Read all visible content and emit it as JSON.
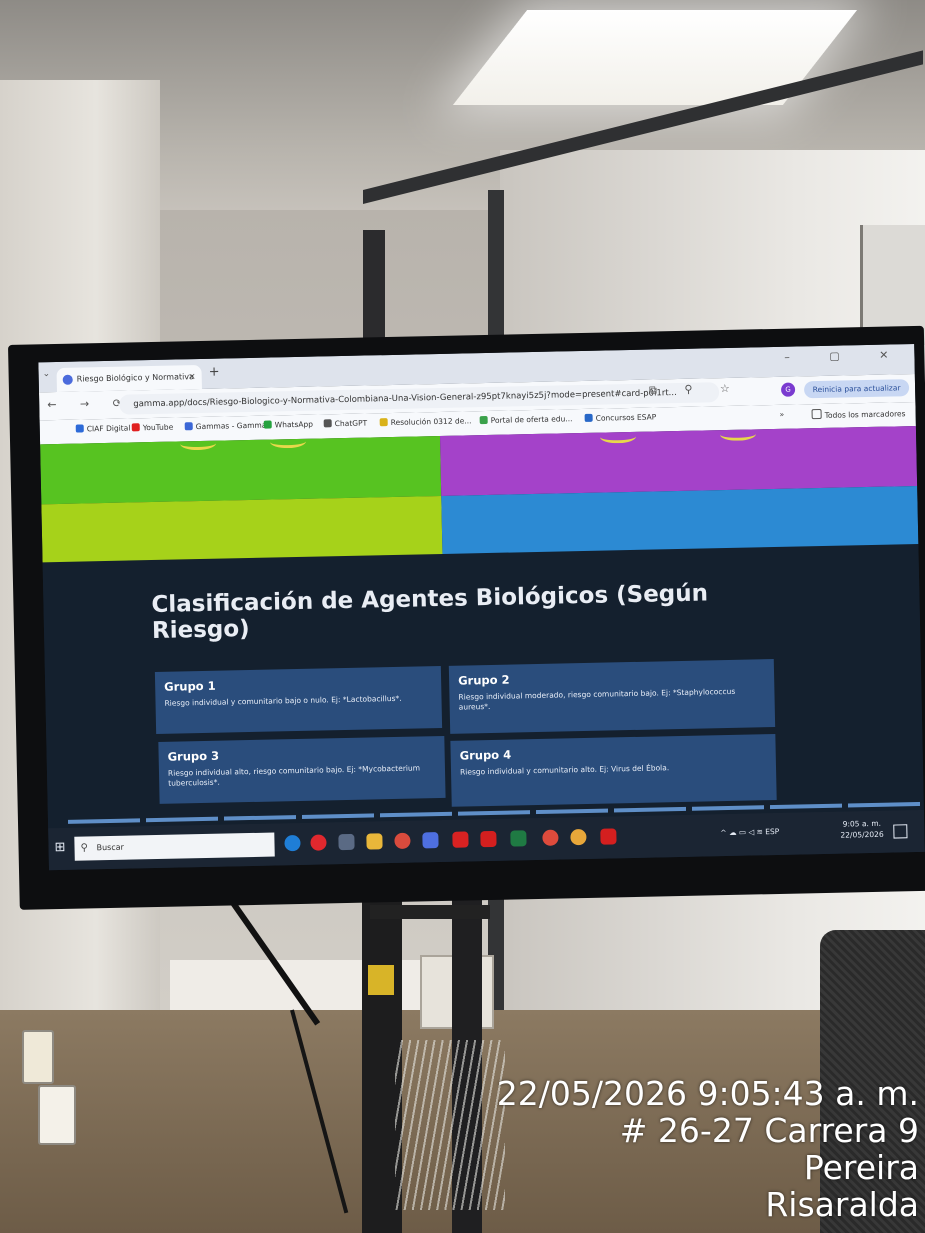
{
  "browser": {
    "tab_title": "Riesgo Biológico y Normativa",
    "tab_close": "×",
    "new_tab": "+",
    "url": "gamma.app/docs/Riesgo-Biologico-y-Normativa-Colombiana-Una-Vision-General-z95pt7knayi5z5j?mode=present#card-p0i1rt...",
    "update_button": "Reinicia para actualizar",
    "profile_initial": "G",
    "bookmarks": [
      "CIAF Digital",
      "YouTube",
      "Gammas - Gamma",
      "WhatsApp",
      "ChatGPT",
      "Resolución 0312 de...",
      "Portal de oferta edu...",
      "Concursos ESAP"
    ],
    "all_bookmarks": "Todos los marcadores",
    "bookmarks_more": "»"
  },
  "slide": {
    "title": "Clasificación de Agentes Biológicos (Según Riesgo)",
    "cards": [
      {
        "title": "Grupo 1",
        "text": "Riesgo individual y comunitario bajo o nulo. Ej: *Lactobacillus*."
      },
      {
        "title": "Grupo 2",
        "text": "Riesgo individual moderado, riesgo comunitario bajo. Ej: *Staphylococcus aureus*."
      },
      {
        "title": "Grupo 3",
        "text": "Riesgo individual alto, riesgo comunitario bajo. Ej: *Mycobacterium tuberculosis*."
      },
      {
        "title": "Grupo 4",
        "text": "Riesgo individual y comunitario alto. Ej: Virus del Ébola."
      }
    ]
  },
  "taskbar": {
    "search_placeholder": "Buscar",
    "language": "ESP",
    "time": "9:05 a. m.",
    "date": "22/05/2026"
  },
  "photo_stamp": {
    "datetime": "22/05/2026 9:05:43 a. m.",
    "address": "# 26-27 Carrera 9",
    "city": "Pereira",
    "region": "Risaralda"
  },
  "colors": {
    "slide_background": "#14202e",
    "card_background": "#2a4d7c",
    "tile_green": "#57c321",
    "tile_lime": "#a6d21a",
    "tile_purple": "#a442c9",
    "tile_blue": "#2c8ad3"
  }
}
